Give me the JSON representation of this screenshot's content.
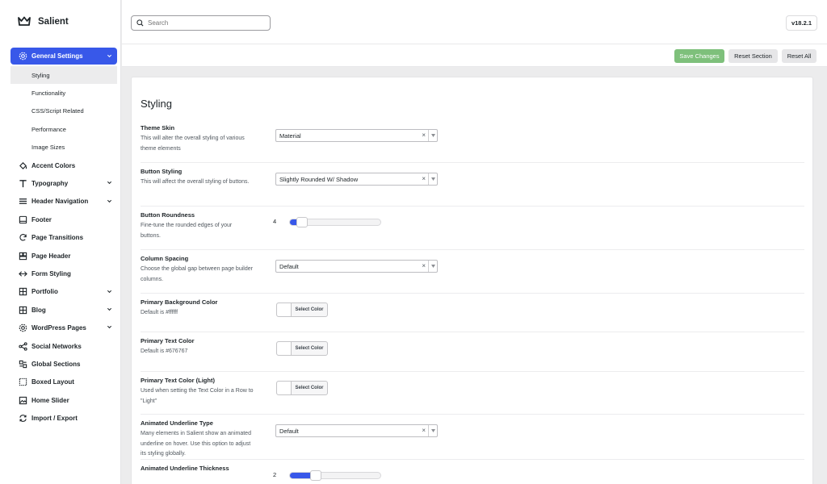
{
  "brand": {
    "name": "Salient"
  },
  "search": {
    "placeholder": "Search"
  },
  "version": "v18.2.1",
  "actions": {
    "save": "Save Changes",
    "reset_section": "Reset Section",
    "reset_all": "Reset All"
  },
  "colors": {
    "accent": "#3858e9",
    "save": "#7ec07b"
  },
  "sidebar": {
    "active": {
      "label": "General Settings",
      "icon": "gear-icon"
    },
    "sub_items": [
      "Styling",
      "Functionality",
      "CSS/Script Related",
      "Performance",
      "Image Sizes"
    ],
    "items": [
      {
        "label": "Accent Colors",
        "icon": "paint-bucket-icon",
        "chevron": false
      },
      {
        "label": "Typography",
        "icon": "typography-icon",
        "chevron": true
      },
      {
        "label": "Header Navigation",
        "icon": "menu-icon",
        "chevron": true
      },
      {
        "label": "Footer",
        "icon": "footer-icon",
        "chevron": false
      },
      {
        "label": "Page Transitions",
        "icon": "refresh-icon",
        "chevron": false
      },
      {
        "label": "Page Header",
        "icon": "layout-icon",
        "chevron": false
      },
      {
        "label": "Form Styling",
        "icon": "form-icon",
        "chevron": false
      },
      {
        "label": "Portfolio",
        "icon": "grid-icon",
        "chevron": true
      },
      {
        "label": "Blog",
        "icon": "grid-icon",
        "chevron": true
      },
      {
        "label": "WordPress Pages",
        "icon": "gear-icon",
        "chevron": true
      },
      {
        "label": "Social Networks",
        "icon": "share-icon",
        "chevron": false
      },
      {
        "label": "Global Sections",
        "icon": "sections-icon",
        "chevron": false
      },
      {
        "label": "Boxed Layout",
        "icon": "boxed-icon",
        "chevron": false
      },
      {
        "label": "Home Slider",
        "icon": "image-icon",
        "chevron": false
      },
      {
        "label": "Import / Export",
        "icon": "sync-icon",
        "chevron": false
      }
    ]
  },
  "panel": {
    "title": "Styling",
    "rows": [
      {
        "label": "Theme Skin",
        "desc": "This will alter the overall styling of various theme elements",
        "control": "select",
        "value": "Material"
      },
      {
        "label": "Button Styling",
        "desc": "This will affect the overall styling of buttons.",
        "control": "select",
        "value": "Slightly Rounded W/ Shadow"
      },
      {
        "label": "Button Roundness",
        "desc": "Fine-tune the rounded edges of your buttons.",
        "control": "slider",
        "value": "4",
        "fraction": 0.08
      },
      {
        "label": "Column Spacing",
        "desc": "Choose the global gap between page builder columns.",
        "control": "select",
        "value": "Default"
      },
      {
        "label": "Primary Background Color",
        "desc": "Default is #ffffff",
        "control": "color",
        "value": "Select Color"
      },
      {
        "label": "Primary Text Color",
        "desc": "Default is #676767",
        "control": "color",
        "value": "Select Color"
      },
      {
        "label": "Primary Text Color (Light)",
        "desc": "Used when setting the Text Color in a Row to \"Light\"",
        "control": "color",
        "value": "Select Color"
      },
      {
        "label": "Animated Underline Type",
        "desc": "Many elements in Salient show an animated underline on hover. Use this option to adjust its styling globally.",
        "control": "select",
        "value": "Default"
      },
      {
        "label": "Animated Underline Thickness",
        "desc": "",
        "control": "slider",
        "value": "2",
        "fraction": 0.26
      }
    ]
  }
}
